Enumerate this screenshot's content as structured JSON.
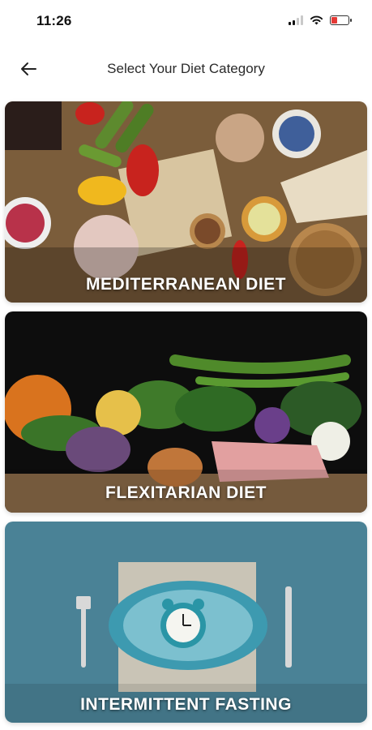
{
  "status_bar": {
    "time": "11:26",
    "icons": [
      "signal-icon",
      "wifi-icon",
      "battery-low-charging-icon"
    ]
  },
  "header": {
    "back_icon": "arrow-left-icon",
    "title": "Select Your Diet Category"
  },
  "categories": [
    {
      "label": "MEDITERRANEAN DIET"
    },
    {
      "label": "FLEXITARIAN DIET"
    },
    {
      "label": "INTERMITTENT FASTING"
    }
  ],
  "colors": {
    "label_text": "#ffffff",
    "battery_low": "#e53935",
    "fasting_background": "#4a8296"
  }
}
